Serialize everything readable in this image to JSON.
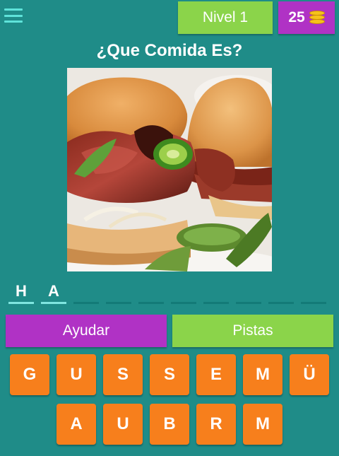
{
  "header": {
    "level_label": "Nivel 1",
    "coins": "25",
    "coin_icon": "coins-icon",
    "menu_icon": "hamburger-menu-icon"
  },
  "question": "¿Que Comida Es?",
  "photo": {
    "subject": "torta sandwich with grilled meat, onions, jalapeño and pickles"
  },
  "answer": {
    "letters": [
      "H",
      "A",
      "",
      "",
      "",
      "",
      "",
      "",
      "",
      ""
    ]
  },
  "buttons": {
    "help_label": "Ayudar",
    "hints_label": "Pistas"
  },
  "keyboard": {
    "row1": [
      "G",
      "U",
      "S",
      "S",
      "E",
      "M",
      "Ü"
    ],
    "row2": [
      "A",
      "U",
      "B",
      "R",
      "M"
    ]
  },
  "colors": {
    "background": "#1f8c88",
    "green": "#8bd44a",
    "purple": "#b032c5",
    "orange": "#f77f1c"
  }
}
